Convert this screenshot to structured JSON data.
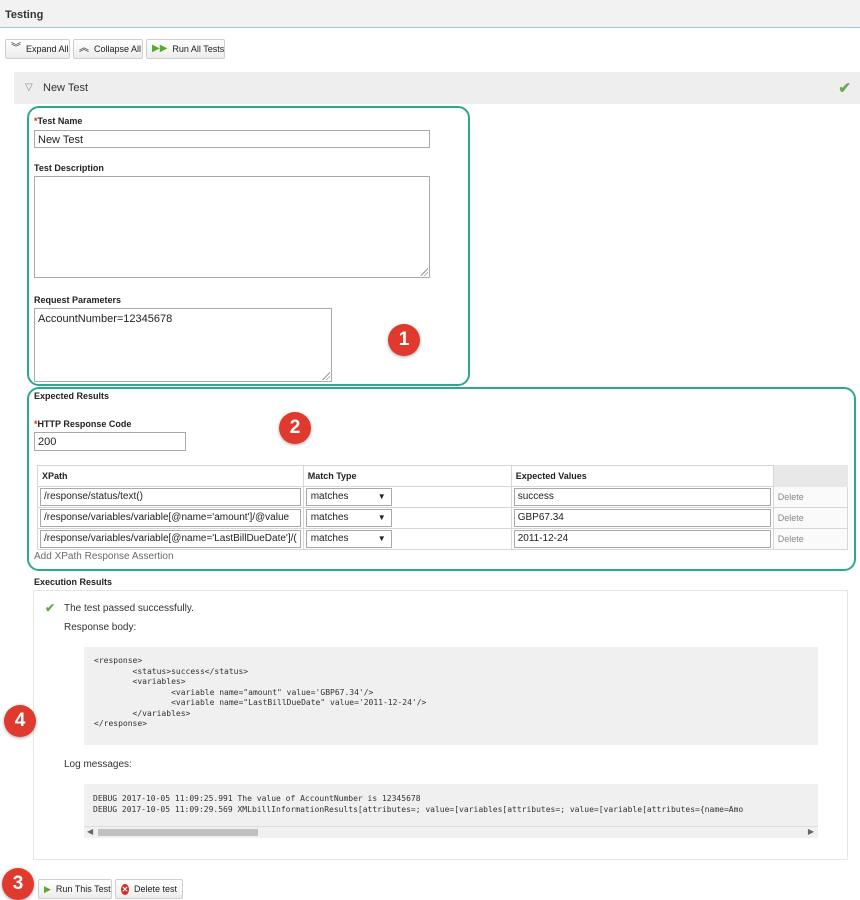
{
  "header": {
    "title": "Testing"
  },
  "toolbar": {
    "expand_all": "Expand All",
    "collapse_all": "Collapse All",
    "run_all": "Run All Tests"
  },
  "test": {
    "header_name": "New Test",
    "status": "passed",
    "fields": {
      "name_label": "Test Name",
      "name_value": "New Test",
      "description_label": "Test Description",
      "description_value": "",
      "params_label": "Request Parameters",
      "params_value": "AccountNumber=12345678"
    },
    "expected": {
      "section_label": "Expected Results",
      "http_code_label": "HTTP Response Code",
      "http_code_value": "200",
      "columns": [
        "XPath",
        "Match Type",
        "Expected Values"
      ],
      "rows": [
        {
          "xpath": "/response/status/text()",
          "match": "matches",
          "value": "success",
          "action": "Delete"
        },
        {
          "xpath": "/response/variables/variable[@name='amount']/@value",
          "match": "matches",
          "value": "GBP67.34",
          "action": "Delete"
        },
        {
          "xpath": "/response/variables/variable[@name='LastBillDueDate']/(",
          "match": "matches",
          "value": "2011-12-24",
          "action": "Delete"
        }
      ],
      "add_link": "Add XPath Response Assertion"
    },
    "execution": {
      "section_label": "Execution Results",
      "result_message": "The test passed successfully.",
      "response_body_label": "Response body:",
      "response_body": "<response>\n        <status>success</status>\n        <variables>\n                <variable name=\"amount\" value='GBP67.34'/>\n                <variable name=\"LastBillDueDate\" value='2011-12-24'/>\n        </variables>\n</response>",
      "log_label": "Log messages:",
      "log_text": "DEBUG 2017-10-05 11:09:25.991 The value of AccountNumber is 12345678\nDEBUG 2017-10-05 11:09:29.569 XMLbillInformationResults[attributes=; value=[variables[attributes=; value=[variable[attributes={name=Amo"
    },
    "actions": {
      "run_this": "Run This Test",
      "delete": "Delete test"
    }
  },
  "markers": [
    "1",
    "2",
    "3",
    "4"
  ],
  "colors": {
    "accent_ring": "#2ea88d",
    "marker": "#e03a2e",
    "success": "#6aa84f",
    "run_icon": "#5aa832",
    "delete_icon": "#d9281e"
  },
  "icons": {
    "expand": "double-chevron-down-icon",
    "collapse": "double-chevron-up-icon",
    "run_all": "double-play-icon",
    "run": "play-icon",
    "delete": "x-circle-icon",
    "passed": "checkmark-icon",
    "toggle": "triangle-down-icon"
  }
}
